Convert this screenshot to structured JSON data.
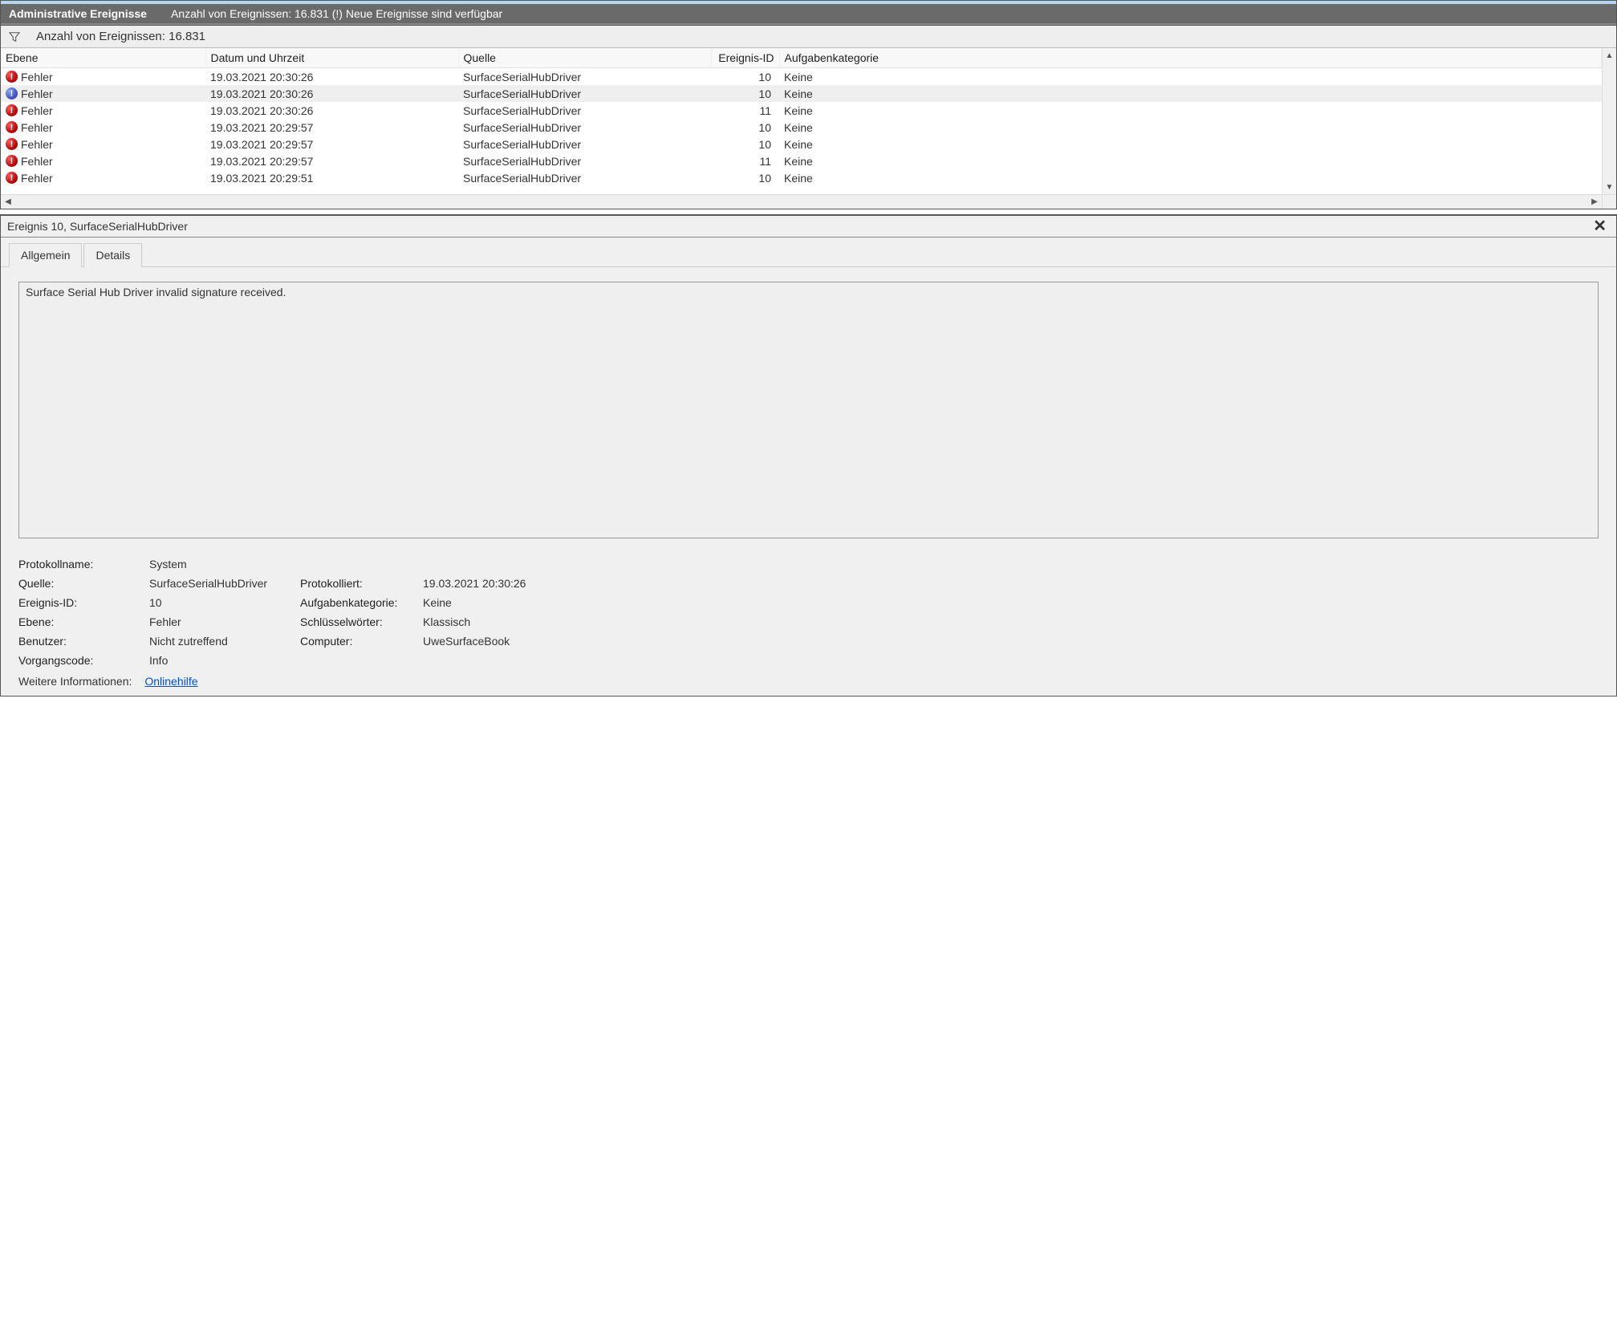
{
  "header": {
    "title": "Administrative Ereignisse",
    "subtitle": "Anzahl von Ereignissen: 16.831 (!) Neue Ereignisse sind verfügbar"
  },
  "filter": {
    "label": "Anzahl von Ereignissen: 16.831"
  },
  "table": {
    "columns": {
      "level": "Ebene",
      "datetime": "Datum und Uhrzeit",
      "source": "Quelle",
      "event_id": "Ereignis-ID",
      "category": "Aufgabenkategorie"
    },
    "rows": [
      {
        "icon": "error",
        "level": "Fehler",
        "datetime": "19.03.2021 20:30:26",
        "source": "SurfaceSerialHubDriver",
        "event_id": "10",
        "category": "Keine",
        "selected": false
      },
      {
        "icon": "info",
        "level": "Fehler",
        "datetime": "19.03.2021 20:30:26",
        "source": "SurfaceSerialHubDriver",
        "event_id": "10",
        "category": "Keine",
        "selected": true
      },
      {
        "icon": "error",
        "level": "Fehler",
        "datetime": "19.03.2021 20:30:26",
        "source": "SurfaceSerialHubDriver",
        "event_id": "11",
        "category": "Keine",
        "selected": false
      },
      {
        "icon": "error",
        "level": "Fehler",
        "datetime": "19.03.2021 20:29:57",
        "source": "SurfaceSerialHubDriver",
        "event_id": "10",
        "category": "Keine",
        "selected": false
      },
      {
        "icon": "error",
        "level": "Fehler",
        "datetime": "19.03.2021 20:29:57",
        "source": "SurfaceSerialHubDriver",
        "event_id": "10",
        "category": "Keine",
        "selected": false
      },
      {
        "icon": "error",
        "level": "Fehler",
        "datetime": "19.03.2021 20:29:57",
        "source": "SurfaceSerialHubDriver",
        "event_id": "11",
        "category": "Keine",
        "selected": false
      },
      {
        "icon": "error",
        "level": "Fehler",
        "datetime": "19.03.2021 20:29:51",
        "source": "SurfaceSerialHubDriver",
        "event_id": "10",
        "category": "Keine",
        "selected": false
      }
    ]
  },
  "detail": {
    "title": "Ereignis 10, SurfaceSerialHubDriver",
    "tabs": {
      "general": "Allgemein",
      "details": "Details"
    },
    "description": "Surface Serial Hub Driver invalid signature received.",
    "labels": {
      "log_name": "Protokollname:",
      "source": "Quelle:",
      "event_id": "Ereignis-ID:",
      "level": "Ebene:",
      "user": "Benutzer:",
      "opcode": "Vorgangscode:",
      "logged": "Protokolliert:",
      "category": "Aufgabenkategorie:",
      "keywords": "Schlüsselwörter:",
      "computer": "Computer:",
      "more_info": "Weitere Informationen:",
      "online_help": "Onlinehilfe"
    },
    "values": {
      "log_name": "System",
      "source": "SurfaceSerialHubDriver",
      "event_id": "10",
      "level": "Fehler",
      "user": "Nicht zutreffend",
      "opcode": "Info",
      "logged": "19.03.2021 20:30:26",
      "category": "Keine",
      "keywords": "Klassisch",
      "computer": "UweSurfaceBook"
    }
  }
}
